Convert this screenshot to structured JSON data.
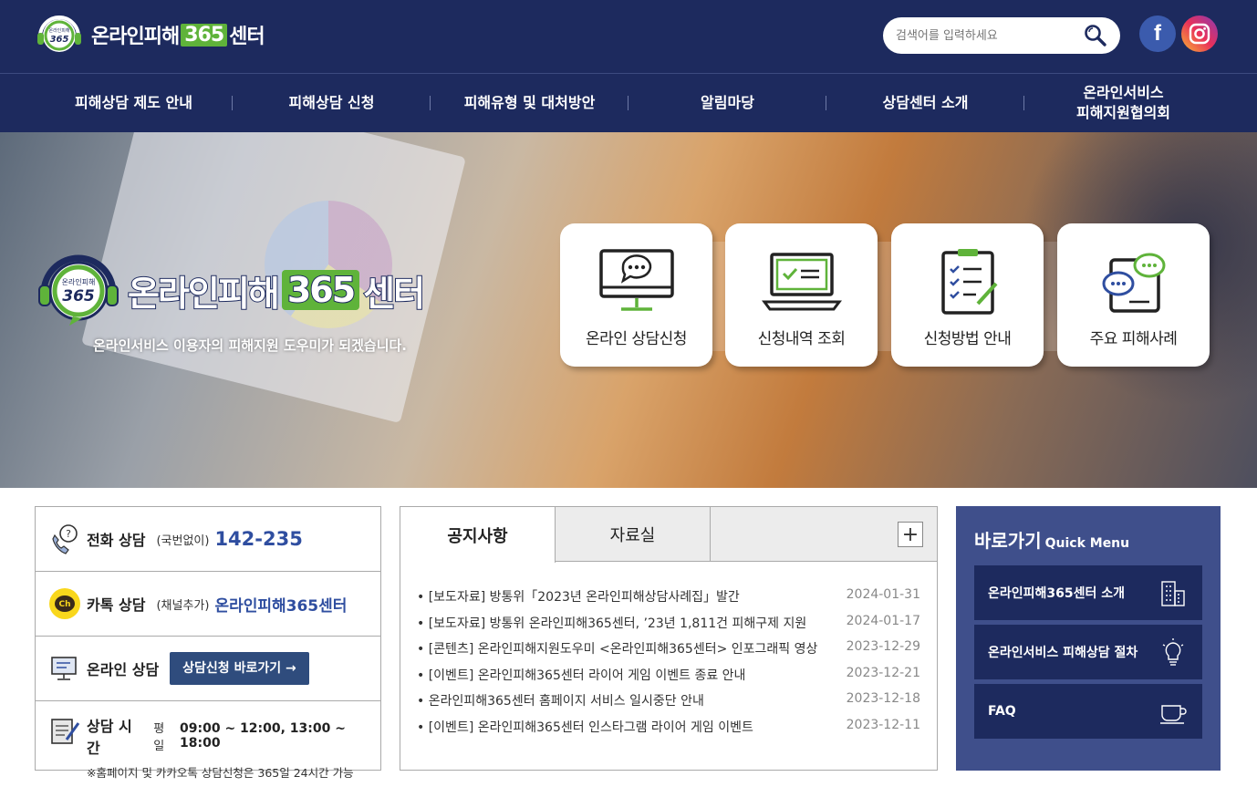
{
  "header": {
    "logo_text_a": "온라인피해",
    "logo_num": "365",
    "logo_text_b": "센터",
    "logo_badge_small": "온라인피해",
    "search_placeholder": "검색어를 입력하세요",
    "facebook": "f"
  },
  "nav": {
    "items": [
      {
        "label": "피해상담 제도 안내"
      },
      {
        "label": "피해상담 신청"
      },
      {
        "label": "피해유형 및 대처방안"
      },
      {
        "label": "알림마당"
      },
      {
        "label": "상담센터 소개"
      },
      {
        "label": "온라인서비스\n피해지원협의회"
      }
    ]
  },
  "hero": {
    "logo_text_a": "온라인피해",
    "logo_num": "365",
    "logo_text_b": "센터",
    "tagline": "온라인서비스 이용자의 피해지원 도우미가 되겠습니다.",
    "cards": [
      {
        "label": "온라인 상담신청",
        "icon": "monitor-chat-icon"
      },
      {
        "label": "신청내역 조회",
        "icon": "laptop-check-icon"
      },
      {
        "label": "신청방법 안내",
        "icon": "clipboard-checklist-icon"
      },
      {
        "label": "주요 피해사례",
        "icon": "chat-bubbles-icon"
      }
    ]
  },
  "contact": {
    "phone": {
      "title": "전화 상담",
      "sub": "(국번없이)",
      "value": "142-235"
    },
    "kakao": {
      "title": "카톡 상담",
      "sub": "(채널추가)",
      "value": "온라인피해365센터"
    },
    "online": {
      "title": "온라인 상담",
      "button": "상담신청 바로가기 →"
    },
    "hours": {
      "title": "상담 시간",
      "sub": "평일",
      "value": "09:00 ~ 12:00, 13:00 ~ 18:00",
      "note": "※홈페이지 및 카카오톡 상담신청은 365일 24시간 가능"
    }
  },
  "news": {
    "tabs": [
      "공지사항",
      "자료실"
    ],
    "more": "+",
    "items": [
      {
        "title": "[보도자료] 방통위「2023년 온라인피해상담사례집」발간",
        "date": "2024-01-31"
      },
      {
        "title": "[보도자료] 방통위 온라인피해365센터, ’23년 1,811건 피해구제 지원",
        "date": "2024-01-17"
      },
      {
        "title": "[콘텐츠] 온라인피해지원도우미 <온라인피해365센터> 인포그래픽 영상",
        "date": "2023-12-29"
      },
      {
        "title": "[이벤트] 온라인피해365센터 라이어 게임 이벤트 종료 안내",
        "date": "2023-12-21"
      },
      {
        "title": "온라인피해365센터 홈페이지 서비스 일시중단 안내",
        "date": "2023-12-18"
      },
      {
        "title": "[이벤트] 온라인피해365센터 인스타그램 라이어 게임 이벤트",
        "date": "2023-12-11"
      }
    ]
  },
  "quick": {
    "title": "바로가기",
    "subtitle": "Quick Menu",
    "items": [
      {
        "label": "온라인피해365센터 소개",
        "icon": "building-icon"
      },
      {
        "label": "온라인서비스 피해상담 절차",
        "icon": "lightbulb-icon"
      },
      {
        "label": "FAQ",
        "icon": "coffee-cup-icon"
      }
    ]
  },
  "colors": {
    "navy": "#1d2a5e",
    "green": "#5fb33a",
    "blue": "#2f4ea0",
    "quick_bg": "#3f4f8b"
  }
}
